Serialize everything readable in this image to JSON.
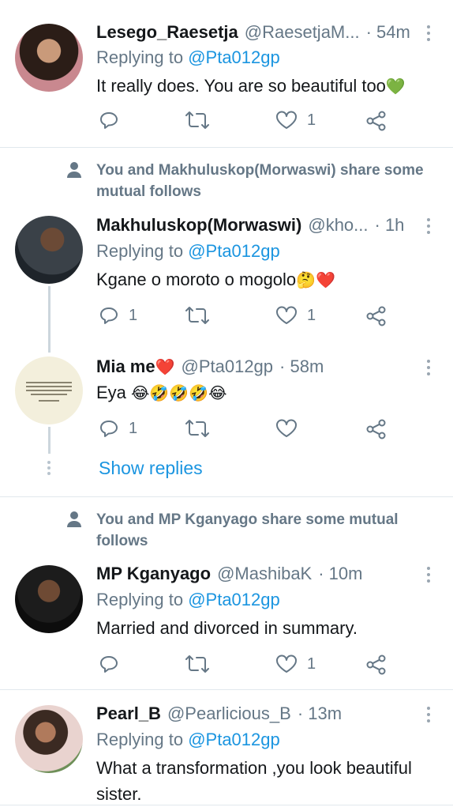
{
  "tweets": [
    {
      "name": "Lesego_Raesetja",
      "handle": "@RaesetjaM...",
      "time": "· 54m",
      "replying_prefix": "Replying to",
      "replying_to": "@Pta012gp",
      "text": "It really does. You are so beautiful too",
      "emoji": "💚",
      "reply_count": "",
      "like_count": "1"
    },
    {
      "social": "You and Makhuluskop(Morwaswi) share some mutual follows",
      "name": "Makhuluskop(Morwaswi)",
      "handle": "@kho...",
      "time": "· 1h",
      "replying_prefix": "Replying to",
      "replying_to": "@Pta012gp",
      "text": "Kgane o moroto o mogolo",
      "emoji": "🤔❤️",
      "reply_count": "1",
      "like_count": "1"
    },
    {
      "name": "Mia me",
      "name_emoji": "❤️",
      "handle": "@Pta012gp",
      "time": "· 58m",
      "text": "Eya",
      "emoji": "😂🤣🤣🤣😂",
      "reply_count": "1",
      "like_count": "",
      "show_replies": "Show replies"
    },
    {
      "social": "You and MP Kganyago share some mutual follows",
      "name": "MP Kganyago",
      "handle": "@MashibaK",
      "time": "· 10m",
      "replying_prefix": "Replying to",
      "replying_to": "@Pta012gp",
      "text": "Married and divorced in summary.",
      "reply_count": "",
      "like_count": "1"
    },
    {
      "name": "Pearl_B",
      "handle": "@Pearlicious_B",
      "time": "· 13m",
      "replying_prefix": "Replying to",
      "replying_to": "@Pta012gp",
      "text": "What a transformation ,you look beautiful sister."
    }
  ],
  "icons": {
    "reply": "reply-icon",
    "retweet": "retweet-icon",
    "like": "heart-icon",
    "share": "share-icon",
    "more": "more-vertical-icon",
    "person": "person-icon"
  },
  "colors": {
    "link": "#1b95e0",
    "muted": "#657786",
    "divider": "#e1e8ed"
  }
}
